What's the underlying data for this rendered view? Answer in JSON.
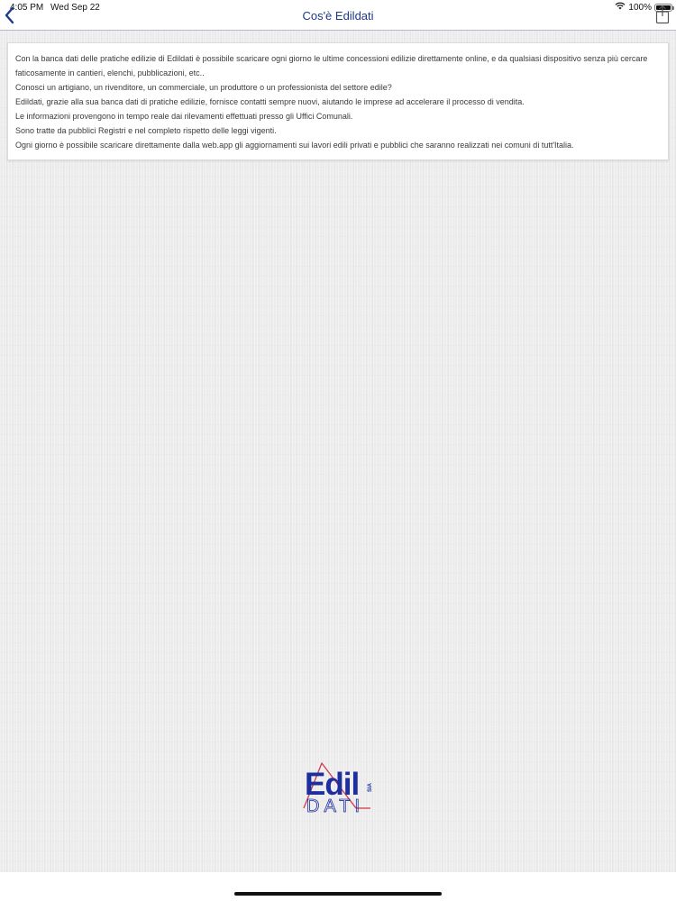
{
  "status_bar": {
    "time": "4:05 PM",
    "date": "Wed Sep 22",
    "battery": "100%"
  },
  "nav": {
    "title": "Cos'è Edildati",
    "back_icon": "chevron-left-icon",
    "share_icon": "share-icon"
  },
  "content": {
    "paragraphs": [
      "Con la banca dati delle pratiche edilizie di Edildati è possibile scaricare ogni giorno le ultime concessioni edilizie direttamente online, e da qualsiasi dispositivo senza più cercare faticosamente in cantieri, elenchi, pubblicazioni, etc..",
      "Conosci un artigiano, un rivenditore, un commerciale, un produttore o un professionista del settore edile?",
      "Edildati, grazie alla sua banca dati di pratiche edilizie, fornisce contatti sempre nuovi, aiutando le imprese ad accelerare il processo di vendita.",
      "Le informazioni provengono in tempo reale dai rilevamenti effettuati presso gli Uffici Comunali.",
      "Sono tratte da pubblici Registri e nel completo rispetto delle leggi vigenti.",
      "Ogni giorno è possibile scaricare direttamente dalla web.app gli aggiornamenti sui lavori edili privati e pubblici che saranno realizzati nei comuni di tutt'Italia."
    ]
  },
  "logo": {
    "word_top": "Edil",
    "word_bottom": "DATI",
    "tag": "SIA"
  },
  "colors": {
    "accent": "#1b3a8c",
    "logo_blue": "#1d2f9e",
    "logo_red": "#d23a46"
  }
}
